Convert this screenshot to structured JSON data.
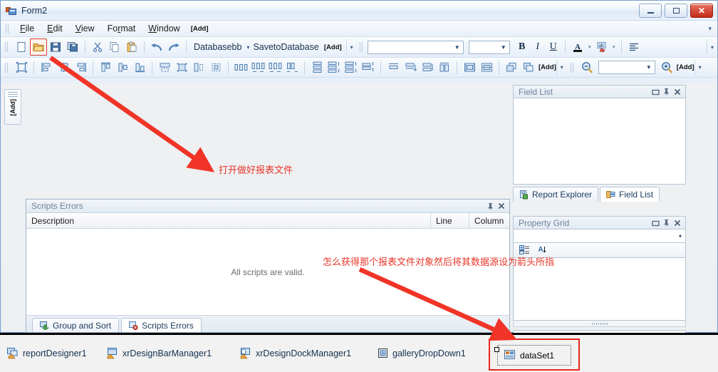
{
  "window": {
    "title": "Form2",
    "icon": "form-icon",
    "buttons": {
      "minimize": "minimize-icon",
      "maximize": "maximize-icon",
      "close": "close-icon"
    }
  },
  "menu": {
    "items": [
      {
        "label": "File",
        "accel": "F"
      },
      {
        "label": "Edit",
        "accel": "E"
      },
      {
        "label": "View",
        "accel": "V"
      },
      {
        "label": "Format",
        "accel": "r"
      },
      {
        "label": "Window",
        "accel": "W"
      }
    ],
    "add_tag": "[Add]",
    "overflow": "▾"
  },
  "toolbar_standard": {
    "buttons": [
      {
        "name": "new-icon",
        "label": ""
      },
      {
        "name": "open-icon",
        "label": ""
      },
      {
        "name": "save-icon",
        "label": ""
      },
      {
        "name": "save-all-icon",
        "label": ""
      },
      {
        "name": "cut-icon",
        "label": ""
      },
      {
        "name": "copy-icon",
        "label": ""
      },
      {
        "name": "paste-icon",
        "label": ""
      },
      {
        "name": "undo-icon",
        "label": ""
      },
      {
        "name": "redo-icon",
        "label": ""
      }
    ],
    "database_label": "Databasebb",
    "database_caret": "▾",
    "save_to_database_label": "SavetoDatabase",
    "save_to_database_add": "[Add]",
    "overflow": "▾"
  },
  "toolbar_font": {
    "font_name_value": "",
    "font_size_value": "",
    "bold": "B",
    "italic": "I",
    "underline": "U",
    "font_color": "A",
    "highlight": "ab",
    "align": "align-left-icon",
    "overflow": "▾"
  },
  "toolbar_layout": {
    "overflow": "▾",
    "add_tag": "[Add]"
  },
  "toolbar_zoom": {
    "zoom_out": "zoom-out-icon",
    "zoom_value": "",
    "zoom_in": "zoom-in-icon",
    "add_tag": "[Add]",
    "overflow": "▾"
  },
  "left_dock_tab": {
    "label": "[Add]"
  },
  "scripts_errors_panel": {
    "title": "Scripts Errors",
    "pin": "pin-icon",
    "close": "close-icon",
    "columns": [
      "Description",
      "Line",
      "Column"
    ],
    "empty_message": "All scripts are valid.",
    "tabs": [
      {
        "label": "Group and Sort",
        "icon": "group-sort-icon",
        "active": false
      },
      {
        "label": "Scripts Errors",
        "icon": "scripts-errors-icon",
        "active": true
      }
    ]
  },
  "field_list_panel": {
    "title": "Field List",
    "restore": "restore-icon",
    "pin": "pin-icon",
    "close": "close-icon",
    "tabs": [
      {
        "label": "Report Explorer",
        "icon": "report-explorer-icon",
        "active": false
      },
      {
        "label": "Field List",
        "icon": "field-list-icon",
        "active": true
      }
    ]
  },
  "property_grid_panel": {
    "title": "Property Grid",
    "restore": "restore-icon",
    "pin": "pin-icon",
    "close": "close-icon",
    "object_combo_value": "",
    "object_combo_caret": "▾",
    "toolbar_buttons": [
      {
        "name": "categorized-icon"
      },
      {
        "name": "alphabetical-icon"
      }
    ]
  },
  "component_tray": {
    "items": [
      {
        "label": "reportDesigner1",
        "icon": "report-designer-icon",
        "selected": false
      },
      {
        "label": "xrDesignBarManager1",
        "icon": "design-bar-manager-icon",
        "selected": false
      },
      {
        "label": "xrDesignDockManager1",
        "icon": "design-dock-manager-icon",
        "selected": false
      },
      {
        "label": "galleryDropDown1",
        "icon": "gallery-dropdown-icon",
        "selected": false
      },
      {
        "label": "dataSet1",
        "icon": "dataset-icon",
        "selected": true
      }
    ]
  },
  "annotations": [
    {
      "text": "打开做好报表文件",
      "color": "#e8362a"
    },
    {
      "text": "怎么获得那个报表文件对象然后将其数据源设为箭头所指",
      "color": "#e8362a"
    }
  ],
  "colors": {
    "accent_red": "#e8362a",
    "selection_red": "#d23b2c",
    "title_text": "#15314f",
    "panel_caption": "#6e8299"
  }
}
